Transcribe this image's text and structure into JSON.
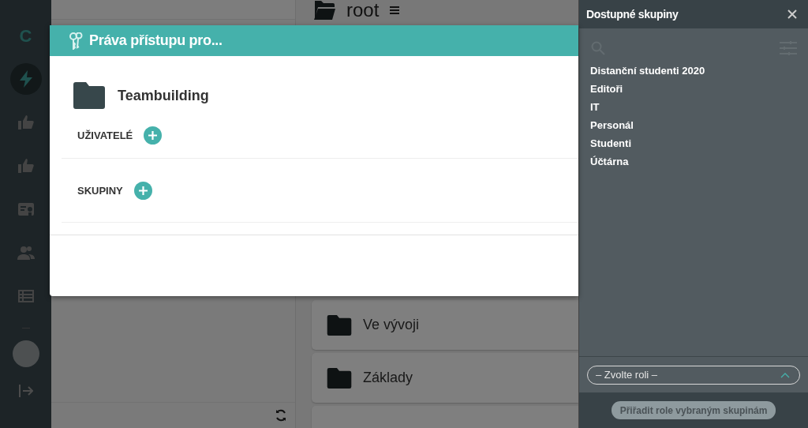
{
  "sidebar": {
    "logo": "C",
    "items": [
      {
        "selected": true
      },
      {
        "selected": false
      },
      {
        "selected": false
      },
      {
        "selected": false
      },
      {
        "selected": false
      },
      {
        "selected": false
      }
    ]
  },
  "main": {
    "title": "root",
    "folders": [
      "Ve vývoji",
      "Základy"
    ]
  },
  "modal": {
    "title": "Práva přístupu pro...",
    "item": "Teambuilding",
    "sections": [
      {
        "label": "UŽIVATELÉ"
      },
      {
        "label": "SKUPINY"
      }
    ]
  },
  "groups_panel": {
    "title": "Dostupné skupiny",
    "groups": [
      {
        "name": "Distanční studenti 2020",
        "selected": false
      },
      {
        "name": "Editoři",
        "selected": false
      },
      {
        "name": "IT",
        "selected": false
      },
      {
        "name": "Personál",
        "selected": false
      },
      {
        "name": "Studenti",
        "selected": false
      },
      {
        "name": "Účtárna",
        "selected": false
      }
    ],
    "role_select": {
      "placeholder": "– Zvolte roli –"
    },
    "assign_button": {
      "label": "Přiřadit role vybraným skupinám",
      "disabled": true
    }
  }
}
